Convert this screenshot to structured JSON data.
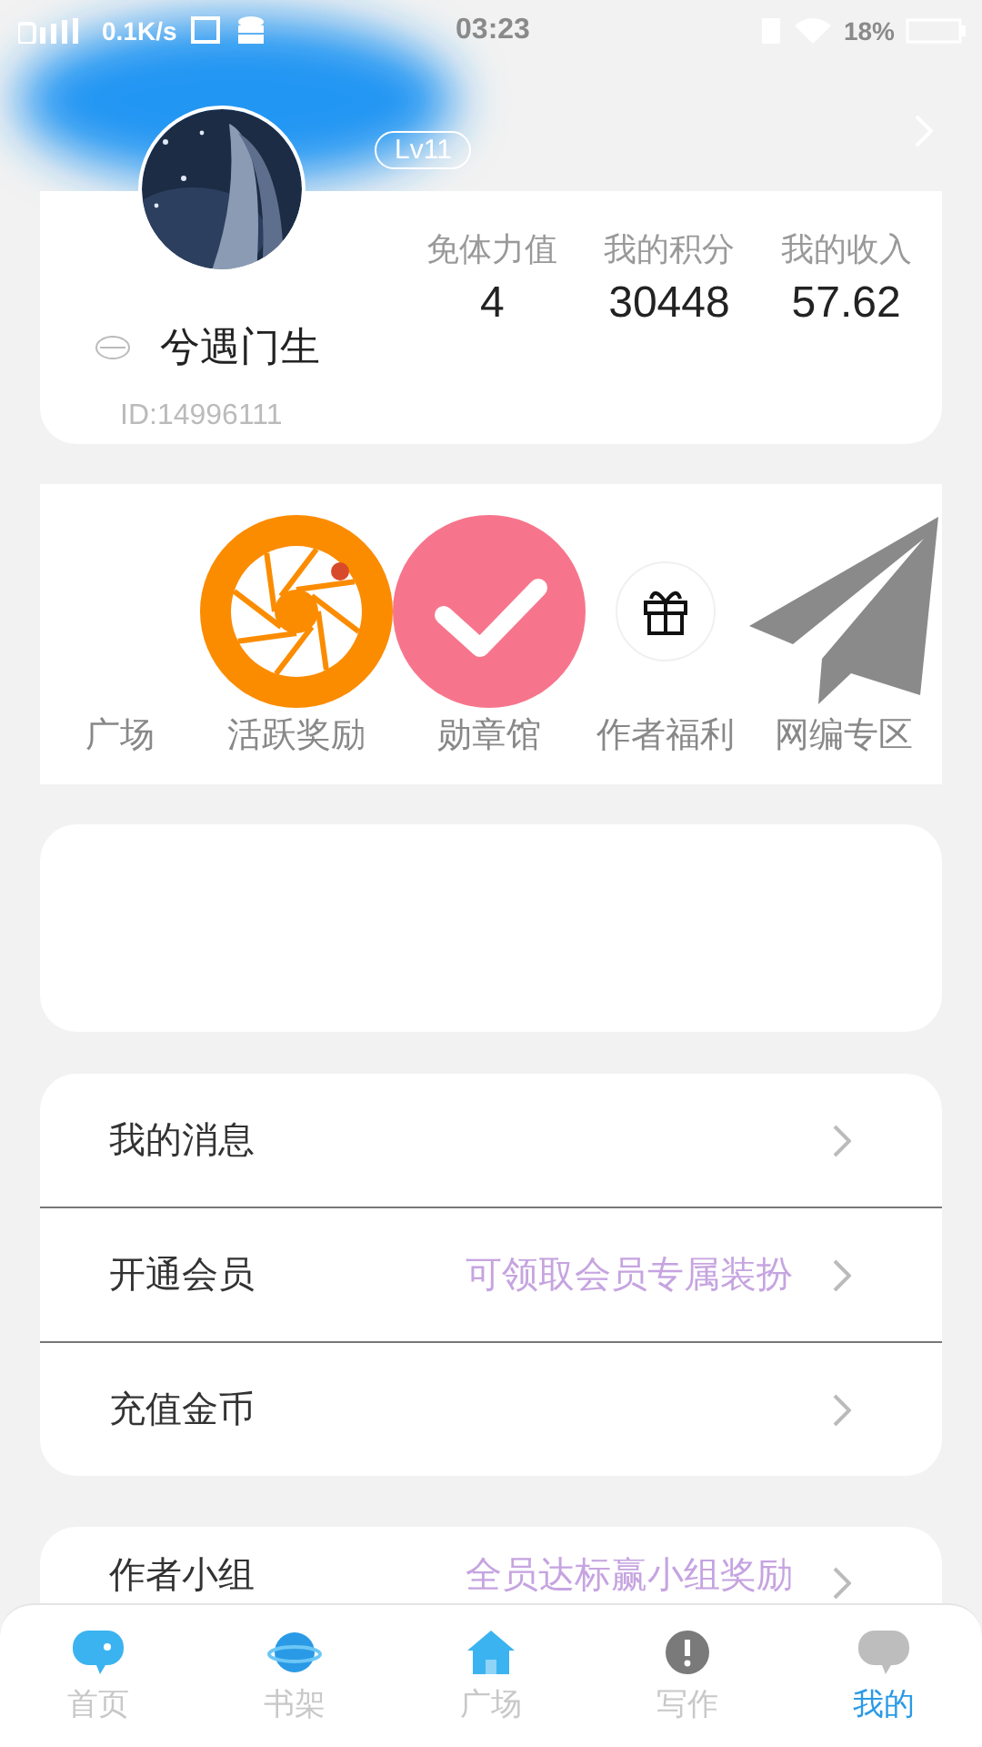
{
  "status_bar": {
    "speed": "0.1K/s",
    "time": "03:23",
    "battery": "18%"
  },
  "profile": {
    "level": "Lv11",
    "name": "兮遇门生",
    "id": "ID:14996111",
    "stats": [
      {
        "label": "免体力值",
        "value": "4"
      },
      {
        "label": "我的积分",
        "value": "30448"
      },
      {
        "label": "我的收入",
        "value": "57.62"
      }
    ]
  },
  "shortcuts": [
    {
      "label": "广场",
      "kind": "none"
    },
    {
      "label": "活跃奖励",
      "kind": "aperture"
    },
    {
      "label": "勋章馆",
      "kind": "check"
    },
    {
      "label": "作者福利",
      "kind": "gift"
    },
    {
      "label": "网编专区",
      "kind": "plane"
    }
  ],
  "menu": [
    {
      "label": "我的消息"
    },
    {
      "label": "开通会员",
      "note": "可领取会员专属装扮"
    },
    {
      "label": "充值金币"
    }
  ],
  "menu2": [
    {
      "label": "作者小组",
      "note": "全员达标赢小组奖励"
    }
  ],
  "tabs": [
    {
      "label": "首页",
      "kind": "chat",
      "selected": false
    },
    {
      "label": "书架",
      "kind": "planet",
      "selected": false
    },
    {
      "label": "广场",
      "kind": "home",
      "selected": false
    },
    {
      "label": "写作",
      "kind": "alert",
      "selected": false
    },
    {
      "label": "我的",
      "kind": "bubble",
      "selected": true
    }
  ]
}
